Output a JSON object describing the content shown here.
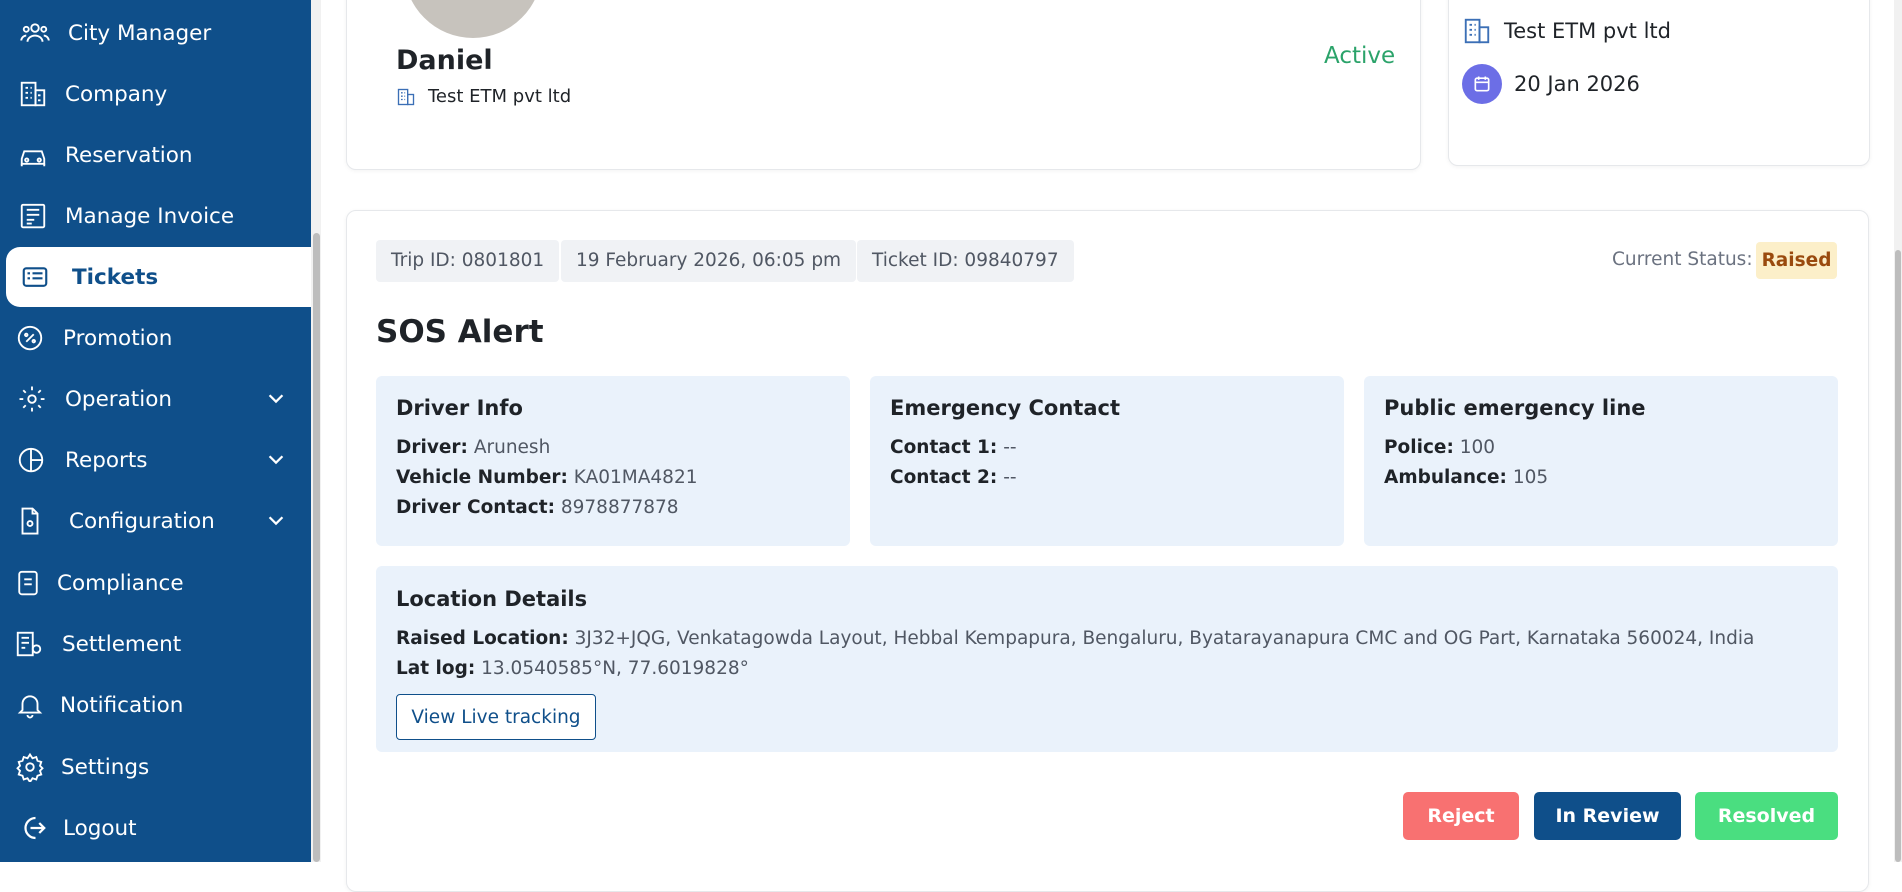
{
  "sidebar": {
    "items": [
      {
        "label": "City Manager",
        "icon": "users-icon"
      },
      {
        "label": "Company",
        "icon": "building-icon"
      },
      {
        "label": "Reservation",
        "icon": "car-icon"
      },
      {
        "label": "Manage Invoice",
        "icon": "invoice-icon"
      },
      {
        "label": "Tickets",
        "icon": "ticket-icon",
        "active": true
      },
      {
        "label": "Promotion",
        "icon": "percent-badge-icon"
      },
      {
        "label": "Operation",
        "icon": "gear-cluster-icon",
        "expandable": true
      },
      {
        "label": "Reports",
        "icon": "pie-chart-icon",
        "expandable": true
      },
      {
        "label": "Configuration",
        "icon": "config-file-icon",
        "expandable": true
      },
      {
        "label": "Compliance",
        "icon": "document-icon"
      },
      {
        "label": "Settlement",
        "icon": "settlement-icon"
      },
      {
        "label": "Notification",
        "icon": "bell-icon"
      },
      {
        "label": "Settings",
        "icon": "gear-icon"
      },
      {
        "label": "Logout",
        "icon": "logout-icon"
      }
    ]
  },
  "profile": {
    "name": "Daniel",
    "company": "Test ETM pvt ltd",
    "status": "Active"
  },
  "summary": {
    "company": "Test ETM pvt ltd",
    "date": "20 Jan 2026"
  },
  "ticket": {
    "trip_id": "Trip ID: 0801801",
    "datetime": "19 February 2026, 06:05 pm",
    "ticket_id": "Ticket ID: 09840797",
    "current_status_label": "Current Status:",
    "current_status": "Raised",
    "title": "SOS Alert"
  },
  "driver_info": {
    "heading": "Driver Info",
    "driver_label": "Driver:",
    "driver": "Arunesh",
    "vehicle_label": "Vehicle Number:",
    "vehicle": "KA01MA4821",
    "contact_label": "Driver Contact:",
    "contact": "8978877878"
  },
  "emergency_contact": {
    "heading": "Emergency Contact",
    "c1_label": "Contact 1:",
    "c1": "--",
    "c2_label": "Contact 2:",
    "c2": "--"
  },
  "public_line": {
    "heading": "Public emergency line",
    "police_label": "Police:",
    "police": "100",
    "ambulance_label": "Ambulance:",
    "ambulance": "105"
  },
  "location": {
    "heading": "Location Details",
    "raised_label": "Raised Location:",
    "raised": "3J32+JQG, Venkatagowda Layout, Hebbal Kempapura, Bengaluru, Byatarayanapura CMC and OG Part, Karnataka 560024, India",
    "latlog_label": "Lat log:",
    "latlog": "13.0540585°N, 77.6019828°",
    "live_button": "View Live tracking"
  },
  "actions": {
    "reject": "Reject",
    "review": "In Review",
    "resolved": "Resolved"
  },
  "colors": {
    "sidebar": "#0f4f8a",
    "active_status": "#2ba36a",
    "raised_bg": "#fcefc9",
    "reject": "#f87171",
    "review": "#0f4f8a",
    "resolved": "#4ade80"
  }
}
